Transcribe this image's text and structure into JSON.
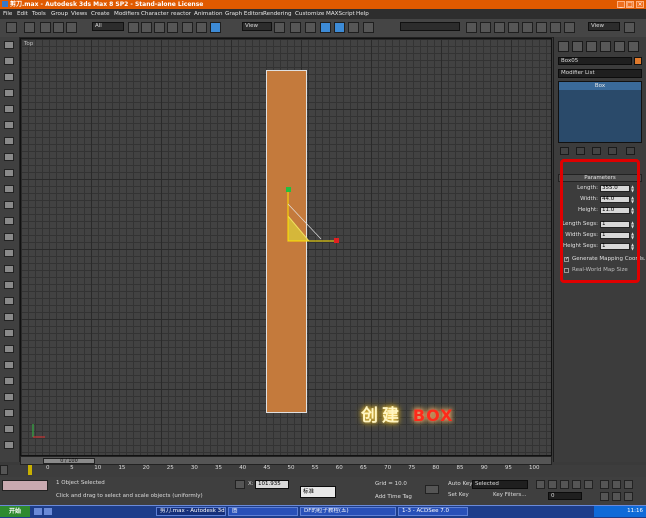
{
  "window": {
    "title": "剪刀.max - Autodesk 3ds Max 8 SP2 - Stand-alone License"
  },
  "menu": [
    "File",
    "Edit",
    "Tools",
    "Group",
    "Views",
    "Create",
    "Modifiers",
    "Character",
    "reactor",
    "Animation",
    "Graph Editors",
    "Rendering",
    "Customize",
    "MAXScript",
    "Help"
  ],
  "toolbar": {
    "selection_filter": "All",
    "ref_coord": "View",
    "named_sel": "",
    "view_drop": "View"
  },
  "viewport": {
    "label": "Top",
    "caption_cn": "创建",
    "caption_box": "BOX"
  },
  "panel": {
    "object_name": "Box05",
    "object_color": "#e07a2c",
    "modifier_list": "Modifier List",
    "stack_item": "Box",
    "rollout_title": "Parameters",
    "params": [
      {
        "label": "Length:",
        "value": "355.0"
      },
      {
        "label": "Width:",
        "value": "44.0"
      },
      {
        "label": "Height:",
        "value": "11.0"
      },
      {
        "label": "Length Segs:",
        "value": "1"
      },
      {
        "label": "Width Segs:",
        "value": "1"
      },
      {
        "label": "Height Segs:",
        "value": "1"
      }
    ],
    "gen_mapping": "Generate Mapping Coords.",
    "real_world": "Real-World Map Size"
  },
  "timeline": {
    "slider": "0 / 100",
    "ticks": [
      "0",
      "5",
      "10",
      "15",
      "20",
      "25",
      "30",
      "35",
      "40",
      "45",
      "50",
      "55",
      "60",
      "65",
      "70",
      "75",
      "80",
      "85",
      "90",
      "95",
      "100"
    ]
  },
  "status": {
    "selected": "1 Object Selected",
    "prompt": "Click and drag to select and scale objects (uniformly)",
    "x_value": "101.935",
    "grid": "Grid = 10.0",
    "add_time_tag": "Add Time Tag",
    "auto_key": "Auto Key",
    "set_key": "Set Key",
    "selected_drop": "Selected",
    "key_filters": "Key Filters...",
    "frame": "0",
    "ime": "标准"
  },
  "taskbar": {
    "start": "开始",
    "tasks": [
      "剪刀.max - Autodesk 3ds...",
      "图",
      "DF的粒子教程(五)",
      "1-3 - ACDSee 7.0"
    ],
    "clock": "11:16"
  }
}
